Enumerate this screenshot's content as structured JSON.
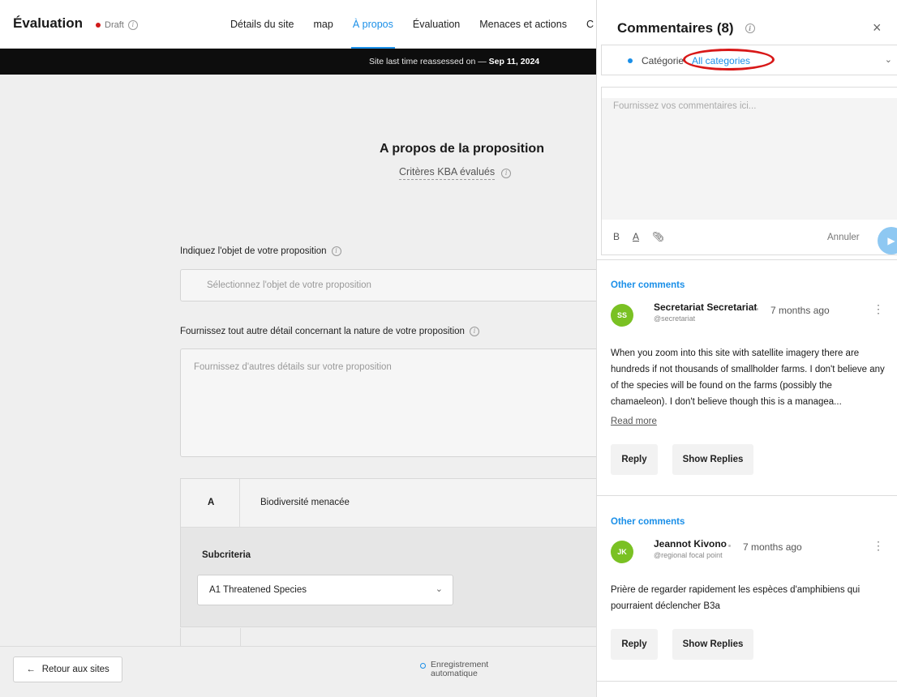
{
  "header": {
    "title": "Évaluation",
    "status": "Draft",
    "tabs": [
      {
        "label": "Détails du site"
      },
      {
        "label": "map"
      },
      {
        "label": "À propos"
      },
      {
        "label": "Évaluation"
      },
      {
        "label": "Menaces et actions"
      },
      {
        "label": "C"
      }
    ]
  },
  "banner": {
    "text": "Site last time reassessed on",
    "dash": "—",
    "date": "Sep 11, 2024"
  },
  "proposal": {
    "title": "A propos de la proposition",
    "criteria_link": "Critères KBA évalués",
    "object_label": "Indiquez l'objet de votre proposition",
    "object_placeholder": "Sélectionnez l'objet de votre proposition",
    "details_label": "Fournissez tout autre détail concernant la nature de votre proposition",
    "details_placeholder": "Fournissez d'autres détails sur votre proposition"
  },
  "criterion": {
    "letter": "A",
    "name": "Biodiversité menacée",
    "subcriteria_label": "Subcriteria",
    "subcriteria_value": "A1 Threatened Species"
  },
  "footer": {
    "back_label": "Retour aux sites",
    "autosave_line1": "Enregistrement",
    "autosave_line2": "automatique"
  },
  "comments_panel": {
    "title": "Commentaires (8)",
    "category_label": "Catégorie",
    "category_value": "All categories",
    "composer_placeholder": "Fournissez vos commentaires ici...",
    "tools": {
      "bold": "B",
      "color": "A"
    },
    "cancel_label": "Annuler",
    "comments": [
      {
        "section": "Other comments",
        "initials": "SS",
        "author": "Secretariat Secretariat",
        "handle": "@secretariat",
        "time": "7 months ago",
        "text": "When you zoom into this site with satellite imagery there are hundreds if not thousands of smallholder farms. I don't believe any of the species will be found on the farms (possibly the chamaeleon). I don't believe though this is a managea...",
        "read_more": "Read more",
        "reply": "Reply",
        "show_replies": "Show Replies"
      },
      {
        "section": "Other comments",
        "initials": "JK",
        "author": "Jeannot Kivono",
        "handle": "@regional focal point",
        "time": "7 months ago",
        "text": "Prière de regarder rapidement les espèces d'amphibiens qui pourraient déclencher B3a",
        "reply": "Reply",
        "show_replies": "Show Replies"
      }
    ]
  },
  "colors": {
    "accent": "#1a8fe8",
    "draft_dot": "#d01a1a",
    "avatar": "#7ac123",
    "highlight": "#d81818"
  }
}
